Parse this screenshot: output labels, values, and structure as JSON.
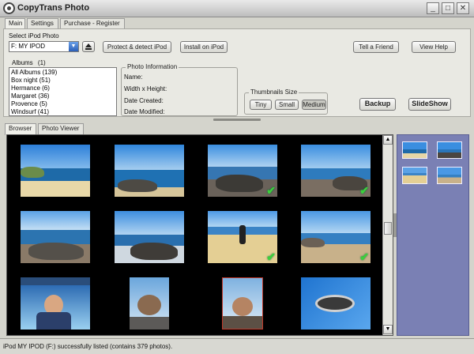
{
  "window": {
    "title": "CopyTrans Photo",
    "controls": [
      "_",
      "□",
      "✕"
    ]
  },
  "top_tabs": [
    {
      "label": "Main",
      "active": true
    },
    {
      "label": "Settings",
      "active": false
    },
    {
      "label": "Purchase - Register",
      "active": false
    }
  ],
  "device": {
    "label": "Select iPod Photo",
    "selected": "F: MY IPOD",
    "eject_icon": "eject-icon"
  },
  "actions": {
    "protect": "Protect & detect iPod",
    "install": "Install on iPod",
    "tell_friend": "Tell a Friend",
    "view_help": "View Help",
    "backup": "Backup",
    "slideshow": "SlideShow"
  },
  "albums": {
    "header": "Albums",
    "count": "(1)",
    "items": [
      "All Albums (139)",
      "Box night (51)",
      "Hermance (6)",
      "Margaret (36)",
      "Provence (5)",
      "Windsurf (41)"
    ]
  },
  "photo_info": {
    "title": "Photo Information",
    "name": "Name:",
    "size": "Width x Height:",
    "created": "Date Created:",
    "modified": "Date Modified:"
  },
  "thumb_size": {
    "title": "Thumbnails Size",
    "options": [
      "Tiny",
      "Small",
      "Medium"
    ],
    "selected": "Medium"
  },
  "view_tabs": [
    {
      "label": "Browser",
      "active": true
    },
    {
      "label": "Photo Viewer",
      "active": false
    }
  ],
  "scrollbar": {
    "up": "▲",
    "down": "▼"
  },
  "thumbnails": [
    {
      "kind": "beach-cove",
      "checked": false
    },
    {
      "kind": "bay-town",
      "checked": false
    },
    {
      "kind": "rocks-surf",
      "checked": true
    },
    {
      "kind": "coast-rocks",
      "checked": true
    },
    {
      "kind": "shore-rocks",
      "checked": false
    },
    {
      "kind": "rock-waves",
      "checked": false
    },
    {
      "kind": "person-beach",
      "checked": true
    },
    {
      "kind": "cliff-beach",
      "checked": true
    },
    {
      "kind": "man-terrace",
      "checked": false
    },
    {
      "kind": "person-table",
      "checked": false
    },
    {
      "kind": "child-chair",
      "checked": false
    },
    {
      "kind": "shoe-blue",
      "checked": false
    }
  ],
  "status": "iPod MY IPOD (F:)  successfully listed (contains 379 photos).",
  "colors": {
    "browser_bg": "#000000",
    "right_panel": "#7a80b4",
    "check": "#3bd13b",
    "selected_border": "#c0392b"
  }
}
